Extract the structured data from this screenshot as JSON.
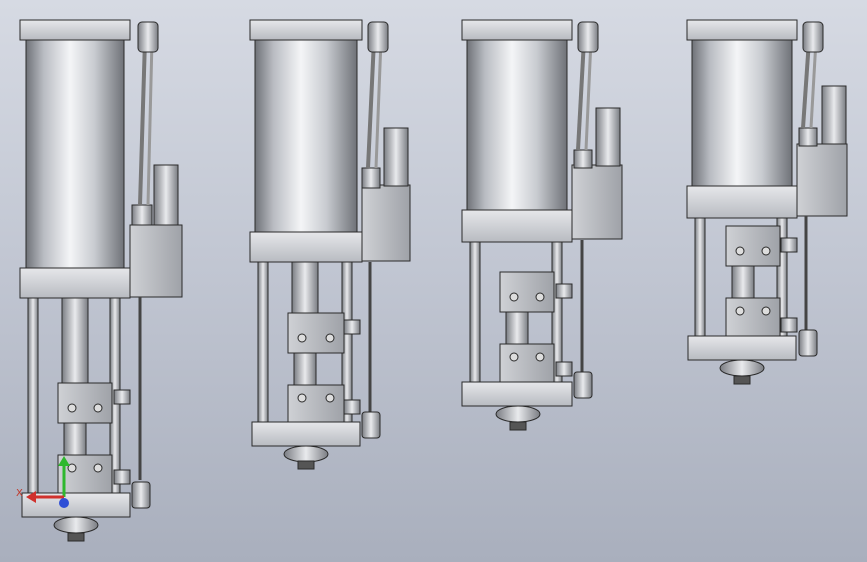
{
  "viewport": {
    "background_top": "#d6dae3",
    "background_bottom": "#a9afbd",
    "model_count": 4
  },
  "triad": {
    "x_label": "X",
    "x_color": "#d0312d",
    "y_color": "#2eb82e",
    "z_color": "#2f4fd6",
    "icon": "coordinate-triad-icon"
  },
  "colors": {
    "steel_dark": "#7c7f85",
    "steel_light": "#f2f3f5",
    "outline": "#2a2a2a",
    "fitting": "#9a9da3"
  }
}
